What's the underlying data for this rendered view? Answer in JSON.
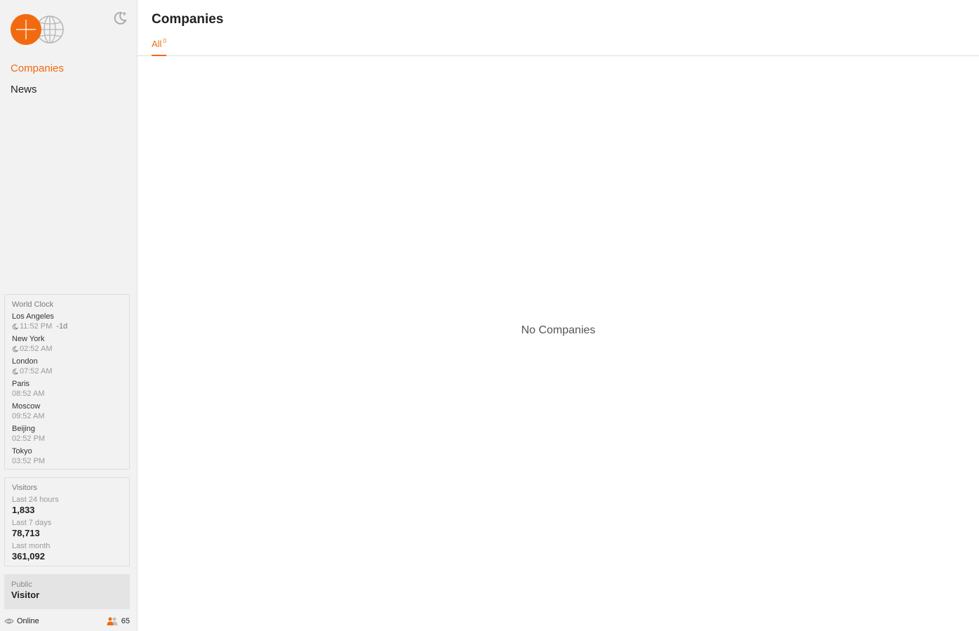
{
  "colors": {
    "accent": "#f26a10",
    "sidebar_bg": "#f2f2f2"
  },
  "sidebar": {
    "logo_icon": "globe-crosshair-logo",
    "theme_toggle_icon": "moon-star-icon",
    "nav": [
      {
        "label": "Companies",
        "active": true
      },
      {
        "label": "News",
        "active": false
      }
    ],
    "world_clock": {
      "title": "World Clock",
      "cities": [
        {
          "name": "Los Angeles",
          "time": "11:52 PM",
          "night": true,
          "offset": "-1d"
        },
        {
          "name": "New York",
          "time": "02:52 AM",
          "night": true,
          "offset": ""
        },
        {
          "name": "London",
          "time": "07:52 AM",
          "night": true,
          "offset": ""
        },
        {
          "name": "Paris",
          "time": "08:52 AM",
          "night": false,
          "offset": ""
        },
        {
          "name": "Moscow",
          "time": "09:52 AM",
          "night": false,
          "offset": ""
        },
        {
          "name": "Beijing",
          "time": "02:52 PM",
          "night": false,
          "offset": ""
        },
        {
          "name": "Tokyo",
          "time": "03:52 PM",
          "night": false,
          "offset": ""
        }
      ]
    },
    "visitors": {
      "title": "Visitors",
      "stats": [
        {
          "label": "Last 24 hours",
          "value": "1,833"
        },
        {
          "label": "Last 7 days",
          "value": "78,713"
        },
        {
          "label": "Last month",
          "value": "361,092"
        }
      ]
    },
    "user": {
      "role": "Public",
      "name": "Visitor"
    },
    "status": {
      "label": "Online",
      "online_count": "65"
    }
  },
  "main": {
    "title": "Companies",
    "tabs": [
      {
        "label": "All",
        "count": "0"
      }
    ],
    "empty_message": "No Companies"
  }
}
